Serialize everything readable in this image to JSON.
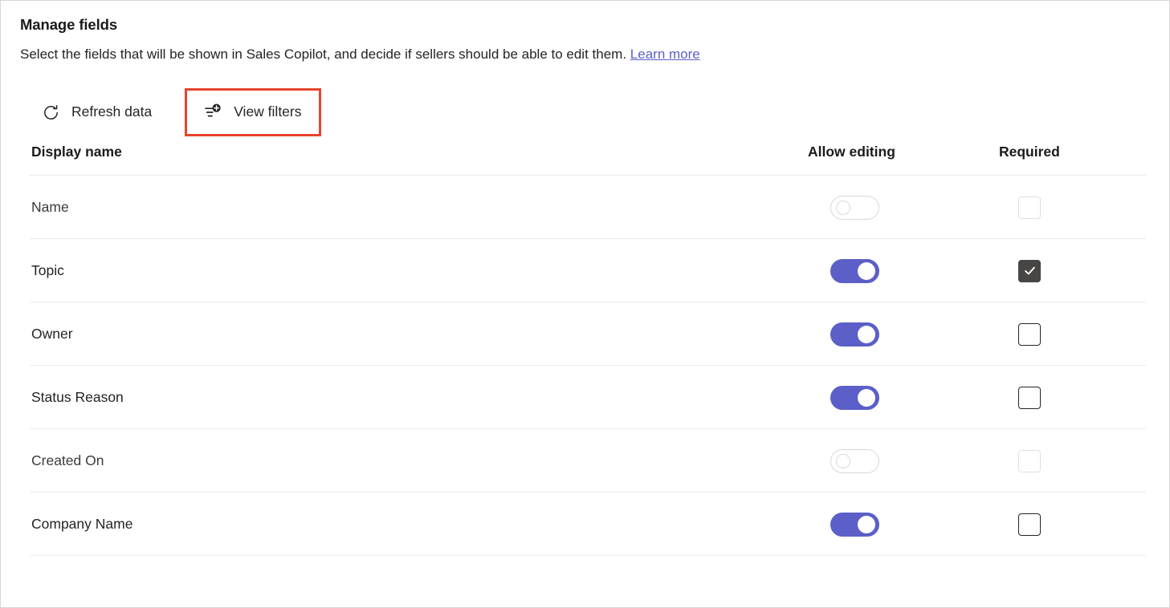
{
  "header": {
    "title": "Manage fields",
    "subtitle_before_link": "Select the fields that will be shown in Sales Copilot, and decide if sellers should be able to edit them.",
    "link_label": "Learn more"
  },
  "command_bar": {
    "refresh": {
      "label": "Refresh data",
      "icon": "refresh-icon"
    },
    "view_filters": {
      "label": "View filters",
      "icon": "add-filter-icon",
      "highlighted": true,
      "highlight_color": "#e8442e"
    }
  },
  "table": {
    "columns": {
      "display_name": "Display name",
      "allow_editing": "Allow editing",
      "required": "Required"
    },
    "rows": [
      {
        "display_name": "Name",
        "allow_editing": false,
        "editing_disabled": true,
        "required": false,
        "required_disabled": true
      },
      {
        "display_name": "Topic",
        "allow_editing": true,
        "editing_disabled": false,
        "required": true,
        "required_disabled": false
      },
      {
        "display_name": "Owner",
        "allow_editing": true,
        "editing_disabled": false,
        "required": false,
        "required_disabled": false
      },
      {
        "display_name": "Status Reason",
        "allow_editing": true,
        "editing_disabled": false,
        "required": false,
        "required_disabled": false
      },
      {
        "display_name": "Created On",
        "allow_editing": false,
        "editing_disabled": true,
        "required": false,
        "required_disabled": true
      },
      {
        "display_name": "Company Name",
        "allow_editing": true,
        "editing_disabled": false,
        "required": false,
        "required_disabled": false
      }
    ]
  },
  "colors": {
    "toggle_on": "#5b5fc7",
    "checkbox_checked": "#484644",
    "link": "#5b5fc7",
    "highlight_border": "#e8442e",
    "divider": "#ebebeb"
  }
}
